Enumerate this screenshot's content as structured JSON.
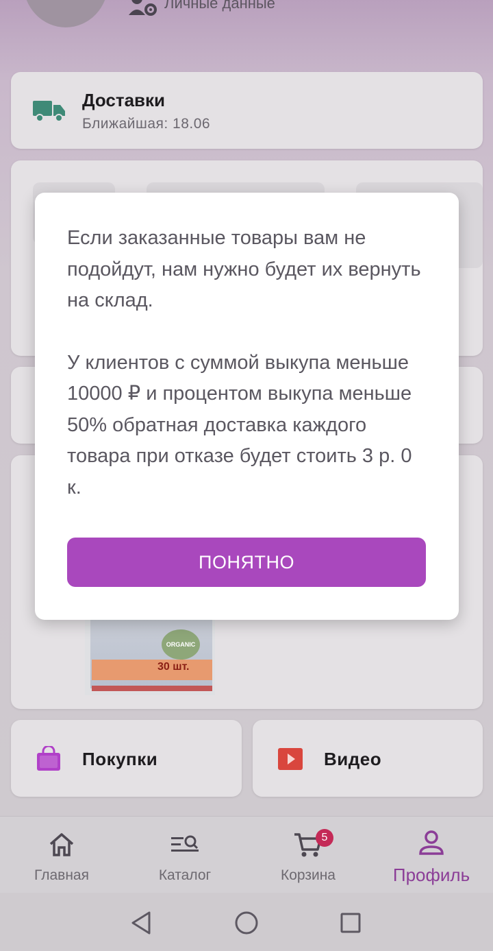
{
  "header": {
    "personal_data_label": "Личные данные"
  },
  "deliveries": {
    "title": "Доставки",
    "subtitle": "Ближайшая: 18.06",
    "icon": "truck-icon"
  },
  "product_image": {
    "badge": "30 шт.",
    "organic_label": "ORGANIC"
  },
  "tiles": [
    {
      "label": "Покупки",
      "icon": "shopping-bag-icon"
    },
    {
      "label": "Видео",
      "icon": "video-play-icon"
    }
  ],
  "bottom_nav": {
    "items": [
      {
        "label": "Главная",
        "icon": "home-icon"
      },
      {
        "label": "Каталог",
        "icon": "catalog-search-icon"
      },
      {
        "label": "Корзина",
        "icon": "cart-icon",
        "badge": "5"
      },
      {
        "label": "Профиль",
        "icon": "profile-icon",
        "active": true
      }
    ]
  },
  "dialog": {
    "paragraph_1": "Если заказанные товары вам не подойдут, нам нужно будет их вернуть на склад.",
    "paragraph_2": "У клиентов с суммой выкупа меньше 10000 ₽ и процентом выкупа меньше 50% обратная доставка каждого товара при отказе будет стоить 3 р. 0 к.",
    "button_label": "ПОНЯТНО"
  },
  "colors": {
    "accent": "#a948bd",
    "active_nav": "#8b3d97",
    "badge": "#c42a57",
    "truck": "#3f8a77"
  }
}
